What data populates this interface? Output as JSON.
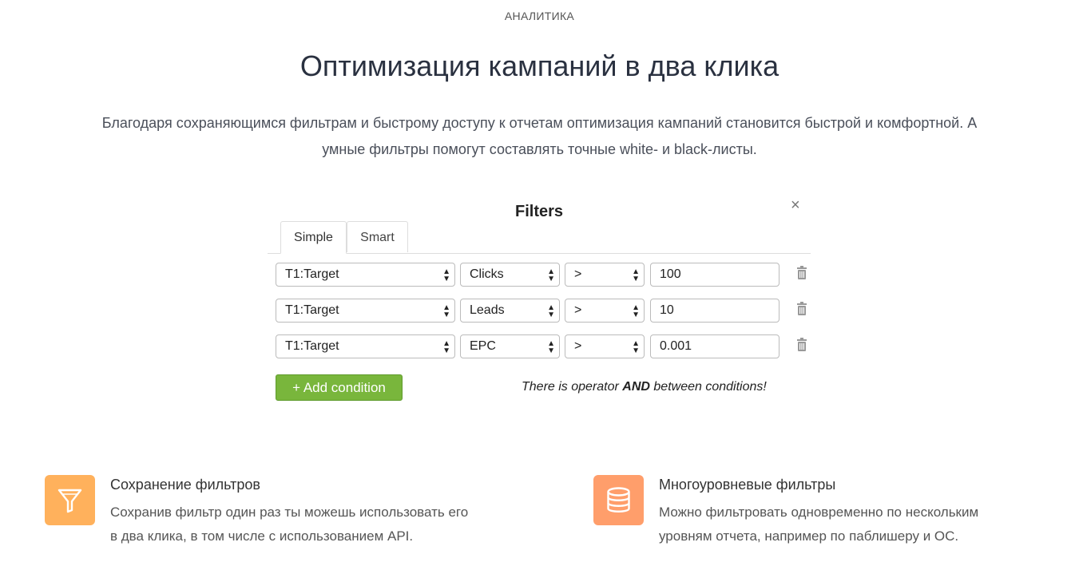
{
  "section": {
    "eyebrow": "АНАЛИТИКА",
    "title": "Оптимизация кампаний в два клика",
    "subtitle": "Благодаря сохраняющимся фильтрам и быстрому доступу к отчетам оптимизация кампаний становится быстрой и комфортной. А умные фильтры помогут составлять точные white- и black-листы."
  },
  "filters_modal": {
    "title": "Filters",
    "close_icon": "×",
    "tabs": [
      {
        "label": "Simple",
        "active": true
      },
      {
        "label": "Smart",
        "active": false
      }
    ],
    "conditions": [
      {
        "field": "T1:Target",
        "metric": "Clicks",
        "operator": ">",
        "value": "100"
      },
      {
        "field": "T1:Target",
        "metric": "Leads",
        "operator": ">",
        "value": "10"
      },
      {
        "field": "T1:Target",
        "metric": "EPC",
        "operator": ">",
        "value": "0.001"
      }
    ],
    "add_button": "+ Add condition",
    "note_prefix": "There is operator ",
    "note_bold": "AND",
    "note_suffix": " between conditions!"
  },
  "features": [
    {
      "icon": "funnel-icon",
      "icon_color": "#ffb15c",
      "title": "Сохранение фильтров",
      "text": "Сохранив фильтр один раз ты можешь использовать его в два клика, в том числе с использованием API."
    },
    {
      "icon": "database-icon",
      "icon_color": "#ff9e6b",
      "title": "Многоуровневые фильтры",
      "text": "Можно фильтровать одновременно по нескольким уровням отчета, например по паблишеру и ОС."
    }
  ]
}
